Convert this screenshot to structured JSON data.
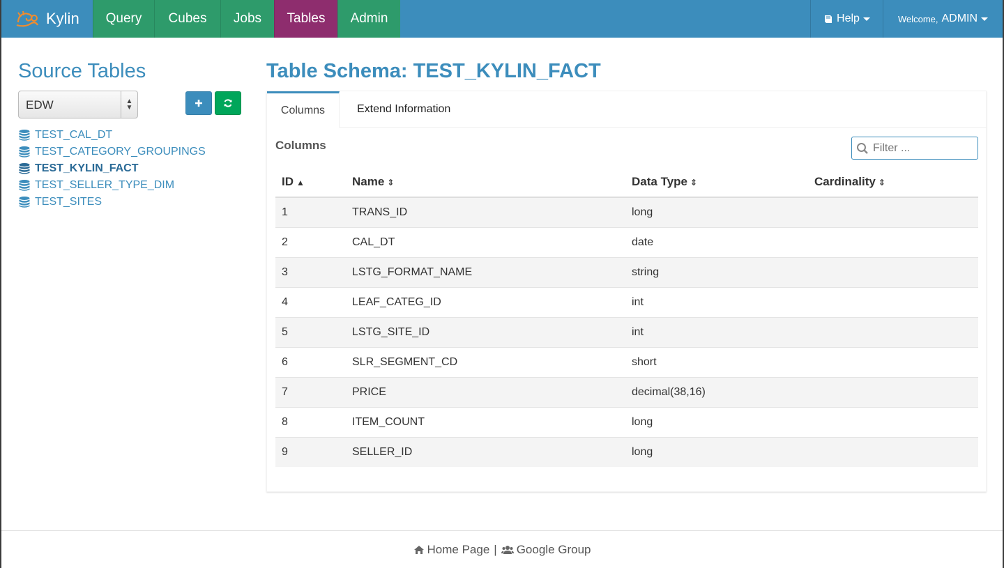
{
  "navbar": {
    "brand": "Kylin",
    "items": [
      {
        "label": "Query"
      },
      {
        "label": "Cubes"
      },
      {
        "label": "Jobs"
      },
      {
        "label": "Tables",
        "active": true
      },
      {
        "label": "Admin"
      }
    ],
    "help_label": "Help",
    "welcome_prefix": "Welcome,",
    "user": "ADMIN"
  },
  "sidebar": {
    "title": "Source Tables",
    "database": "EDW",
    "tables": [
      {
        "label": "TEST_CAL_DT"
      },
      {
        "label": "TEST_CATEGORY_GROUPINGS"
      },
      {
        "label": "TEST_KYLIN_FACT",
        "active": true
      },
      {
        "label": "TEST_SELLER_TYPE_DIM"
      },
      {
        "label": "TEST_SITES"
      }
    ]
  },
  "main": {
    "title": "Table Schema: TEST_KYLIN_FACT",
    "tabs": [
      {
        "label": "Columns",
        "active": true
      },
      {
        "label": "Extend Information"
      }
    ],
    "section_label": "Columns",
    "filter_placeholder": "Filter ...",
    "headers": {
      "id": "ID",
      "name": "Name",
      "data_type": "Data Type",
      "cardinality": "Cardinality"
    },
    "rows": [
      {
        "id": "1",
        "name": "TRANS_ID",
        "data_type": "long",
        "cardinality": ""
      },
      {
        "id": "2",
        "name": "CAL_DT",
        "data_type": "date",
        "cardinality": ""
      },
      {
        "id": "3",
        "name": "LSTG_FORMAT_NAME",
        "data_type": "string",
        "cardinality": ""
      },
      {
        "id": "4",
        "name": "LEAF_CATEG_ID",
        "data_type": "int",
        "cardinality": ""
      },
      {
        "id": "5",
        "name": "LSTG_SITE_ID",
        "data_type": "int",
        "cardinality": ""
      },
      {
        "id": "6",
        "name": "SLR_SEGMENT_CD",
        "data_type": "short",
        "cardinality": ""
      },
      {
        "id": "7",
        "name": "PRICE",
        "data_type": "decimal(38,16)",
        "cardinality": ""
      },
      {
        "id": "8",
        "name": "ITEM_COUNT",
        "data_type": "long",
        "cardinality": ""
      },
      {
        "id": "9",
        "name": "SELLER_ID",
        "data_type": "long",
        "cardinality": ""
      }
    ]
  },
  "footer": {
    "home_label": "Home Page",
    "separator": "|",
    "group_label": "Google Group"
  },
  "colors": {
    "navbar": "#3c8dbc",
    "nav_green": "#2e9b6b",
    "nav_active": "#8e2d6e",
    "accent": "#3c8dbc",
    "refresh_button": "#00a65a"
  }
}
